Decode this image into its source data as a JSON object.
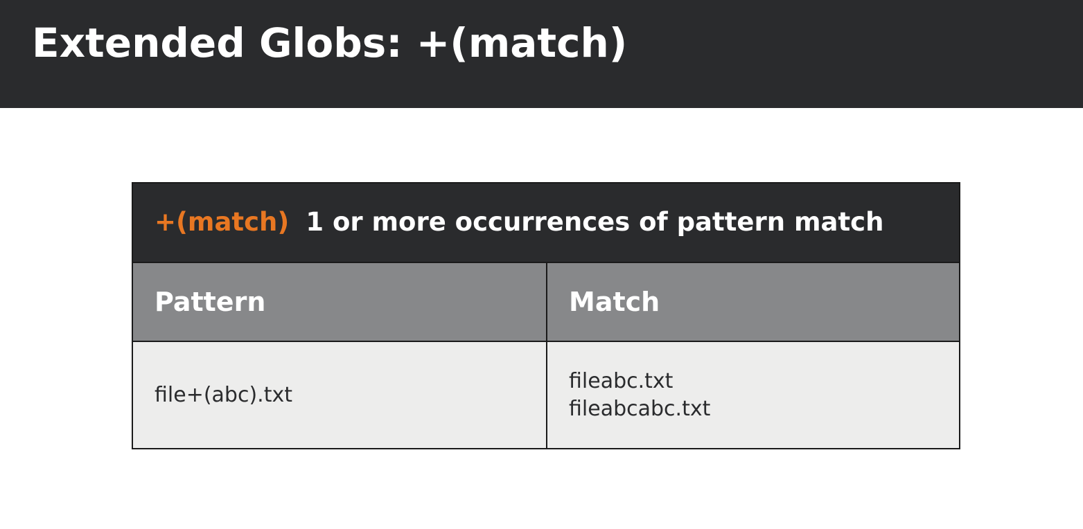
{
  "slide": {
    "title": "Extended Globs: +(match)"
  },
  "table": {
    "header": {
      "operator": "+(match)",
      "description": "1 or more occurrences of pattern match"
    },
    "columns": [
      "Pattern",
      "Match"
    ],
    "rows": [
      {
        "pattern": "file+(abc).txt",
        "matches": [
          "fileabc.txt",
          "fileabcabc.txt"
        ]
      }
    ]
  },
  "colors": {
    "title_bar": "#2a2b2d",
    "operator_accent": "#e87722",
    "column_header_bg": "#87888a",
    "body_bg": "#ededec"
  }
}
